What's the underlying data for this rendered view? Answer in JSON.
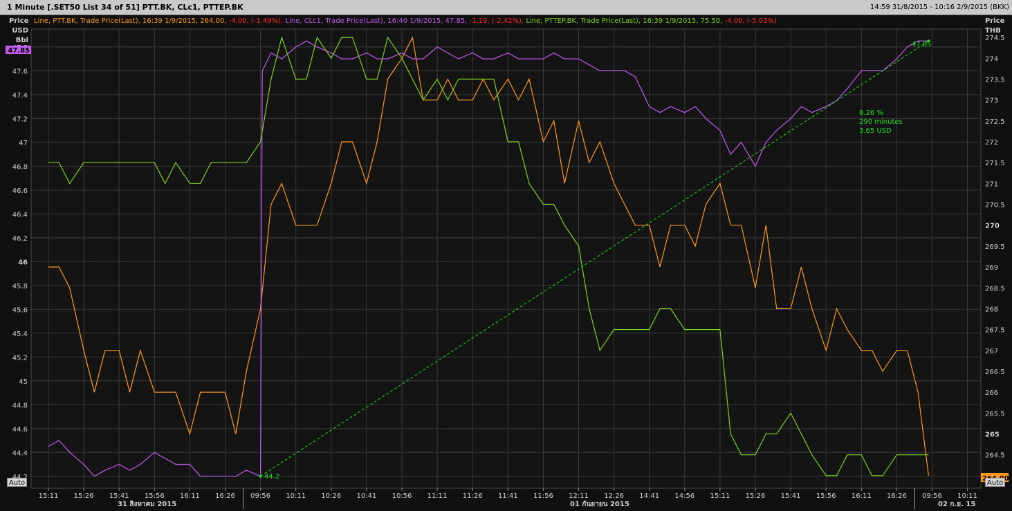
{
  "window": {
    "title": "1 Minute [.SET50 List 34 of 51] PTT.BK, CLc1, PTTEP.BK",
    "date_range": "14:59 31/8/2015 - 10:16 2/9/2015 (BKK)"
  },
  "legend": {
    "ptt": {
      "prefix": "Line, PTT.BK, Trade Price(Last), 16:39 1/9/2015, 264.00, ",
      "change": "-4.00, (-1.49%), "
    },
    "clc1": {
      "prefix": "Line, CLc1, Trade Price(Last), 16:40 1/9/2015, 47.85, ",
      "change": "-1.19, (-2.42%), "
    },
    "pttep": {
      "prefix": "Line, PTTEP.BK, Trade Price(Last), 16:39 1/9/2015, 75.50, ",
      "change": "-4.00, (-5.03%)"
    }
  },
  "axes": {
    "left_title_1": "Price",
    "left_title_2": "USD",
    "left_title_3": "Bbl",
    "right_title_1": "Price",
    "right_title_2": "THB",
    "left_last_badge": "47.85",
    "right_last_badge": "264.00",
    "auto_left": "Auto",
    "auto_right": "Auto",
    "date_label_1": "31 สิงหาคม 2015",
    "date_label_2": "01 กันยายน 2015",
    "date_label_3": "02 ก.ย. 15"
  },
  "annotation": {
    "start_label": "44.2",
    "end_label": "47.85",
    "line1": "8.26 %",
    "line2": "290 minutes",
    "line3": "3.65 USD"
  },
  "colors": {
    "background": "#101010",
    "grid": "#3a3a3a",
    "ptt": "#ff9a1f",
    "clc1": "#c35cf2",
    "pttep": "#7ed321",
    "trend": "#20e020",
    "negative": "#ff2a2a",
    "tick_text": "#d0d0d0"
  },
  "chart_data": {
    "type": "line",
    "x_ticks": [
      "15:11",
      "15:26",
      "15:41",
      "15:56",
      "16:11",
      "16:26",
      "09:56",
      "10:11",
      "10:26",
      "10:41",
      "10:56",
      "11:11",
      "11:26",
      "11:41",
      "11:56",
      "12:11",
      "12:26",
      "14:41",
      "14:56",
      "15:11",
      "15:26",
      "15:41",
      "15:56",
      "16:11",
      "16:26",
      "09:56",
      "10:11"
    ],
    "x_sessions": [
      {
        "label": "31 สิงหาคม 2015",
        "from": 0,
        "to": 6
      },
      {
        "label": "01 กันยายน 2015",
        "from": 6,
        "to": 25
      },
      {
        "label": "02 ก.ย. 15",
        "from": 25,
        "to": 27
      }
    ],
    "y_left": {
      "title": "Price USD Bbl",
      "range": [
        44.1,
        47.95
      ],
      "ticks": [
        44.2,
        44.4,
        44.6,
        44.8,
        45,
        45.2,
        45.4,
        45.6,
        45.8,
        46,
        46.2,
        46.4,
        46.6,
        46.8,
        47,
        47.2,
        47.4,
        47.6,
        47.8
      ],
      "bold": [
        46
      ]
    },
    "y_right": {
      "title": "Price THB",
      "range": [
        263.7,
        274.7
      ],
      "ticks": [
        264,
        264.5,
        265,
        265.5,
        266,
        266.5,
        267,
        267.5,
        268,
        268.5,
        269,
        269.5,
        270,
        270.5,
        271,
        271.5,
        272,
        272.5,
        273,
        273.5,
        274,
        274.5
      ],
      "bold": [
        265,
        270
      ]
    },
    "series": [
      {
        "name": "PTT.BK",
        "axis": "right",
        "x": [
          0,
          0.3,
          0.6,
          1,
          1.3,
          1.6,
          2,
          2.3,
          2.6,
          3,
          3.3,
          3.6,
          4,
          4.3,
          4.6,
          5,
          5.3,
          5.6,
          6,
          6.3,
          6.6,
          7,
          7.3,
          7.6,
          8,
          8.3,
          8.6,
          9,
          9.3,
          9.6,
          10,
          10.3,
          10.6,
          11,
          11.3,
          11.6,
          12,
          12.3,
          12.6,
          13,
          13.3,
          13.6,
          14,
          14.3,
          14.6,
          15,
          15.3,
          15.6,
          16,
          16.3,
          16.6,
          17,
          17.3,
          17.6,
          18,
          18.3,
          18.6,
          19,
          19.3,
          19.6,
          20,
          20.3,
          20.6,
          21,
          21.3,
          21.6,
          22,
          22.3,
          22.6,
          23,
          23.3,
          23.6,
          24,
          24.3,
          24.6,
          24.9
        ],
        "values": [
          269,
          269,
          268.5,
          267,
          266,
          267,
          267,
          266,
          267,
          266,
          266,
          266,
          265,
          266,
          266,
          266,
          265,
          266.5,
          268,
          270.5,
          271,
          270,
          270,
          270,
          271,
          272,
          272,
          271,
          272,
          273.5,
          274,
          274.5,
          273,
          273,
          273.5,
          273,
          273,
          273.5,
          273,
          273.5,
          273,
          273.5,
          272,
          272.5,
          271,
          272.5,
          271.5,
          272,
          271,
          270.5,
          270,
          270,
          269,
          270,
          270,
          269.5,
          270.5,
          271,
          270,
          270,
          268.5,
          270,
          268,
          268,
          269,
          268,
          267,
          268,
          267.5,
          267,
          267,
          266.5,
          267,
          267,
          266,
          264
        ]
      },
      {
        "name": "CLc1",
        "axis": "left",
        "x": [
          0,
          0.3,
          0.6,
          1,
          1.3,
          1.6,
          2,
          2.3,
          2.6,
          3,
          3.3,
          3.6,
          4,
          4.3,
          4.6,
          5,
          5.3,
          5.6,
          6,
          6.05,
          6.3,
          6.6,
          7,
          7.3,
          7.6,
          8,
          8.3,
          8.6,
          9,
          9.3,
          9.6,
          10,
          10.3,
          10.6,
          11,
          11.3,
          11.6,
          12,
          12.3,
          12.6,
          13,
          13.3,
          13.6,
          14,
          14.3,
          14.6,
          15,
          15.3,
          15.6,
          16,
          16.3,
          16.6,
          17,
          17.3,
          17.6,
          18,
          18.3,
          18.6,
          19,
          19.3,
          19.6,
          20,
          20.3,
          20.6,
          21,
          21.3,
          21.6,
          22,
          22.3,
          22.6,
          23,
          23.3,
          23.6,
          24,
          24.3,
          24.6,
          24.9
        ],
        "values": [
          44.45,
          44.5,
          44.4,
          44.3,
          44.2,
          44.25,
          44.3,
          44.25,
          44.3,
          44.4,
          44.35,
          44.3,
          44.3,
          44.2,
          44.2,
          44.2,
          44.2,
          44.25,
          44.2,
          47.6,
          47.75,
          47.7,
          47.8,
          47.85,
          47.8,
          47.75,
          47.7,
          47.7,
          47.75,
          47.7,
          47.7,
          47.75,
          47.7,
          47.7,
          47.8,
          47.75,
          47.7,
          47.75,
          47.7,
          47.7,
          47.75,
          47.7,
          47.7,
          47.7,
          47.75,
          47.7,
          47.7,
          47.65,
          47.6,
          47.6,
          47.6,
          47.55,
          47.3,
          47.25,
          47.3,
          47.25,
          47.3,
          47.2,
          47.1,
          46.9,
          47.0,
          46.8,
          47.0,
          47.1,
          47.2,
          47.3,
          47.25,
          47.3,
          47.35,
          47.45,
          47.6,
          47.6,
          47.6,
          47.7,
          47.8,
          47.85,
          47.85
        ]
      },
      {
        "name": "PTTEP.BK",
        "axis": "right",
        "x": [
          0,
          0.3,
          0.6,
          1,
          1.3,
          1.6,
          2,
          2.3,
          2.6,
          3,
          3.3,
          3.6,
          4,
          4.3,
          4.6,
          5,
          5.3,
          5.6,
          6,
          6.3,
          6.6,
          7,
          7.3,
          7.6,
          8,
          8.3,
          8.6,
          9,
          9.3,
          9.6,
          10,
          10.3,
          10.6,
          11,
          11.3,
          11.6,
          12,
          12.3,
          12.6,
          13,
          13.3,
          13.6,
          14,
          14.3,
          14.6,
          15,
          15.3,
          15.6,
          16,
          16.3,
          16.6,
          17,
          17.3,
          17.6,
          18,
          18.3,
          18.6,
          19,
          19.3,
          19.6,
          20,
          20.3,
          20.6,
          21,
          21.3,
          21.6,
          22,
          22.3,
          22.6,
          23,
          23.3,
          23.6,
          24,
          24.3,
          24.6,
          24.9
        ],
        "values": [
          271.5,
          271.5,
          271,
          271.5,
          271.5,
          271.5,
          271.5,
          271.5,
          271.5,
          271.5,
          271,
          271.5,
          271,
          271,
          271.5,
          271.5,
          271.5,
          271.5,
          272,
          273.5,
          274.5,
          273.5,
          273.5,
          274.5,
          274,
          274.5,
          274.5,
          273.5,
          273.5,
          274.5,
          274,
          273.5,
          273,
          273.5,
          273,
          273.5,
          273.5,
          273.5,
          273.5,
          272,
          272,
          271,
          270.5,
          270.5,
          270,
          269.5,
          268,
          267,
          267.5,
          267.5,
          267.5,
          267.5,
          268,
          268,
          267.5,
          267.5,
          267.5,
          267.5,
          265,
          264.5,
          264.5,
          265,
          265,
          265.5,
          265,
          264.5,
          264,
          264,
          264.5,
          264.5,
          264,
          264,
          264.5,
          264.5,
          264.5,
          264.5
        ]
      }
    ],
    "trend": {
      "from": {
        "x": 6,
        "y": 44.2
      },
      "to": {
        "x": 24.9,
        "y": 47.85
      },
      "axis": "left"
    }
  }
}
